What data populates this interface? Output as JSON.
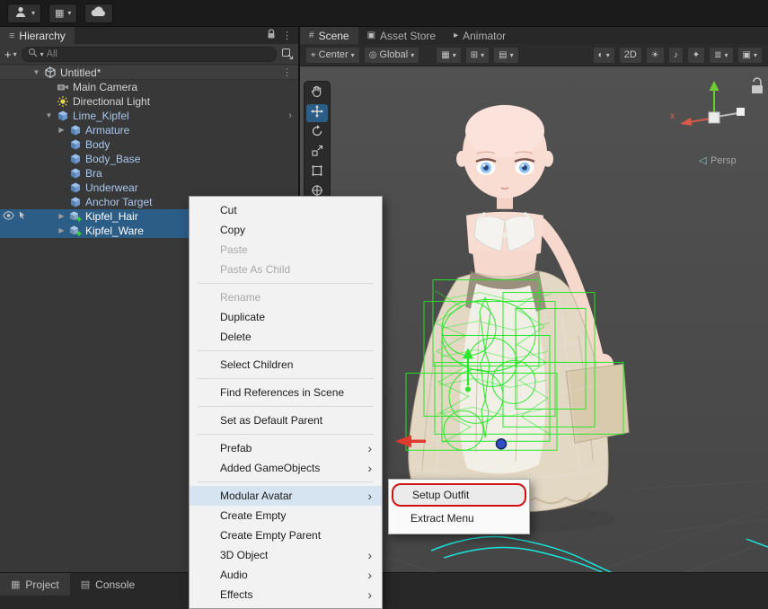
{
  "glyphs": {
    "caret": "▾",
    "kebab": "⋮",
    "panel_menu": "≡",
    "chevron": "›",
    "tri_open": "▼",
    "tri_closed": "▶",
    "grid": "▦"
  },
  "topbar": {},
  "hierarchy": {
    "tab_label": "Hierarchy",
    "add_label": "+",
    "search_text": "All",
    "rows": [
      {
        "label": "Untitled*",
        "icon": "scene",
        "level": 0,
        "tri": "open",
        "trailing": "kebab",
        "color": "default"
      },
      {
        "label": "Main Camera",
        "icon": "camera",
        "level": 1,
        "color": "default"
      },
      {
        "label": "Directional Light",
        "icon": "light",
        "level": 1,
        "color": "default"
      },
      {
        "label": "Lime_Kipfel",
        "icon": "prefab",
        "level": 1,
        "tri": "open",
        "trailing": "chevron",
        "color": "prefab"
      },
      {
        "label": "Armature",
        "icon": "prefab",
        "level": 2,
        "tri": "closed",
        "color": "prefab"
      },
      {
        "label": "Body",
        "icon": "prefab",
        "level": 2,
        "color": "prefab"
      },
      {
        "label": "Body_Base",
        "icon": "prefab",
        "level": 2,
        "color": "prefab"
      },
      {
        "label": "Bra",
        "icon": "prefab",
        "level": 2,
        "color": "prefab"
      },
      {
        "label": "Underwear",
        "icon": "prefab",
        "level": 2,
        "color": "prefab"
      },
      {
        "label": "Anchor Target",
        "icon": "prefab",
        "level": 2,
        "color": "prefab"
      },
      {
        "label": "Kipfel_Hair",
        "icon": "added",
        "level": 2,
        "tri": "closed",
        "selected": true,
        "gutter": true,
        "color": "default"
      },
      {
        "label": "Kipfel_Ware",
        "icon": "added",
        "level": 2,
        "tri": "closed",
        "selected": true,
        "color": "default"
      }
    ]
  },
  "context_menu": {
    "items": [
      {
        "label": "Cut"
      },
      {
        "label": "Copy"
      },
      {
        "label": "Paste",
        "disabled": true
      },
      {
        "label": "Paste As Child",
        "disabled": true
      },
      {
        "sep": true
      },
      {
        "label": "Rename",
        "disabled": true
      },
      {
        "label": "Duplicate"
      },
      {
        "label": "Delete"
      },
      {
        "sep": true
      },
      {
        "label": "Select Children"
      },
      {
        "sep": true
      },
      {
        "label": "Find References in Scene"
      },
      {
        "sep": true
      },
      {
        "label": "Set as Default Parent"
      },
      {
        "sep": true
      },
      {
        "label": "Prefab",
        "submenu": true
      },
      {
        "label": "Added GameObjects",
        "submenu": true
      },
      {
        "sep": true
      },
      {
        "label": "Modular Avatar",
        "submenu": true,
        "highlight": true
      },
      {
        "label": "Create Empty"
      },
      {
        "label": "Create Empty Parent"
      },
      {
        "label": "3D Object",
        "submenu": true
      },
      {
        "label": "Audio",
        "submenu": true
      },
      {
        "label": "Effects",
        "submenu": true
      }
    ]
  },
  "submenu": {
    "items": [
      {
        "label": "Setup Outfit",
        "highlight": true
      },
      {
        "label": "Extract Menu"
      }
    ]
  },
  "scene": {
    "tabs": [
      {
        "name": "tab-scene",
        "icon": "#",
        "label": "Scene",
        "active": true
      },
      {
        "name": "tab-asset-store",
        "icon": "▣",
        "label": "Asset Store"
      },
      {
        "name": "tab-animator",
        "icon": "▸",
        "label": "Animator"
      }
    ],
    "toolbar": {
      "left": [
        {
          "name": "pivot-mode-button",
          "icon": "⌖",
          "label": "Center",
          "caret": "▾"
        },
        {
          "name": "orientation-mode-button",
          "icon": "◎",
          "label": "Global",
          "caret": "▾"
        }
      ],
      "mid": [
        {
          "name": "grid-visibility-button",
          "icon": "▦",
          "caret": "▾"
        },
        {
          "name": "snap-settings-button",
          "icon": "⊞",
          "caret": "▾"
        },
        {
          "name": "snap-increment-button",
          "icon": "▤",
          "caret": "▾"
        }
      ],
      "right": [
        {
          "name": "shading-mode-button",
          "icon": "◐",
          "caret": "▾"
        },
        {
          "name": "2d-toggle-button",
          "label": "2D"
        },
        {
          "name": "lighting-toggle-button",
          "icon": "☀"
        },
        {
          "name": "audio-toggle-button",
          "icon": "♪"
        },
        {
          "name": "effects-toggle-button",
          "icon": "✦"
        },
        {
          "name": "layers-dropdown-button",
          "icon": "≣",
          "caret": "▾"
        },
        {
          "name": "camera-dropdown-button",
          "icon": "▣",
          "caret": "▾"
        }
      ]
    },
    "tools": [
      {
        "name": "hand-tool"
      },
      {
        "name": "move-tool",
        "active": true
      },
      {
        "name": "rotate-tool"
      },
      {
        "name": "scale-tool"
      },
      {
        "name": "rect-tool"
      },
      {
        "name": "transform-tool"
      }
    ],
    "gizmo": {
      "x_label": "x",
      "persp_arrow": "◁",
      "persp_label": "Persp"
    }
  },
  "bottom": {
    "tabs": [
      {
        "name": "tab-project",
        "icon": "▦",
        "label": "Project",
        "active": true
      },
      {
        "name": "tab-console",
        "icon": "▤",
        "label": "Console"
      }
    ]
  }
}
